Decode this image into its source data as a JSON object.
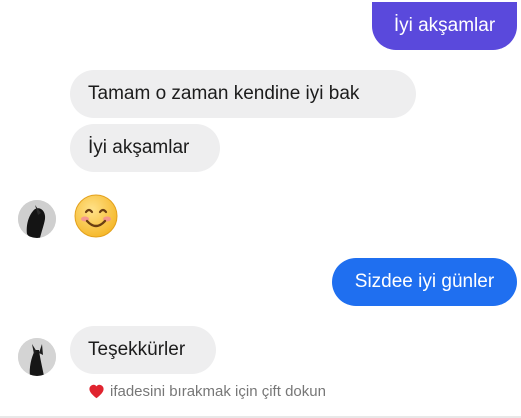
{
  "colors": {
    "outgoing_top": "#5a49dc",
    "outgoing_bottom": "#1f6ff0",
    "incoming_bubble": "#eeeeef",
    "hint_text": "#777777",
    "heart": "#e0242f",
    "emoji_face": "#ffcb3d"
  },
  "messages": [
    {
      "direction": "outgoing",
      "text": "İyi akşamlar"
    },
    {
      "direction": "incoming",
      "text": "Tamam o zaman kendine iyi bak"
    },
    {
      "direction": "incoming",
      "text": "İyi akşamlar"
    },
    {
      "direction": "incoming",
      "text": "😊",
      "type": "emoji",
      "emoji_icon": "smiling-face-icon"
    },
    {
      "direction": "outgoing",
      "text": "Sizdee iyi günler"
    },
    {
      "direction": "incoming",
      "text": "Teşekkürler"
    }
  ],
  "reaction_hint": {
    "icon": "heart-icon",
    "text": "ifadesini bırakmak için çift dokun"
  }
}
